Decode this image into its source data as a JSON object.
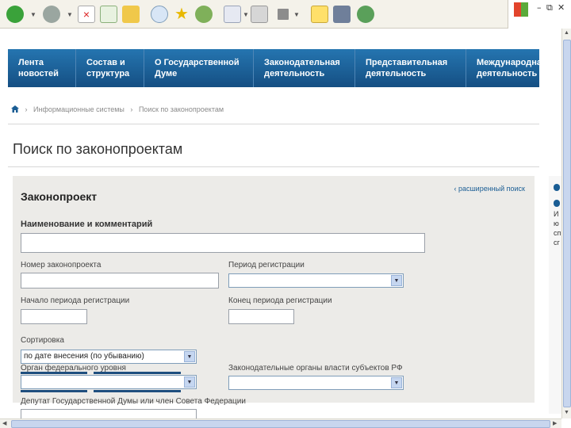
{
  "nav": {
    "items": [
      {
        "label": "Лента\nновостей"
      },
      {
        "label": "Состав и\nструктура"
      },
      {
        "label": "О Государственной\nДуме"
      },
      {
        "label": "Законодательная\nдеятельность"
      },
      {
        "label": "Представительная\nдеятельность"
      },
      {
        "label": "Международная\nдеятельность"
      }
    ]
  },
  "breadcrumb": {
    "items": [
      "Информационные системы",
      "Поиск по законопроектам"
    ]
  },
  "page_title": "Поиск по законопроектам",
  "panel": {
    "title": "Законопроект",
    "advanced_link": "расширенный поиск",
    "name_section": "Наименование и комментарий",
    "number_label": "Номер законопроекта",
    "period_label": "Период регистрации",
    "start_label": "Начало периода регистрации",
    "end_label": "Конец периода регистрации",
    "sort_label": "Сортировка",
    "sort_value": "по дате внесения (по убыванию)",
    "federal_label": "Орган федерального уровня",
    "regional_label": "Законодательные органы власти субъектов РФ",
    "deputy_label": "Депутат Государственной Думы или член Совета Федерации"
  },
  "sidebar": {
    "lines": [
      "И",
      "ю",
      "сп",
      "сг"
    ]
  },
  "colors": {
    "nav_bg": "#1a5d94",
    "panel_bg": "#ecebe8",
    "link": "#1a5d94"
  }
}
